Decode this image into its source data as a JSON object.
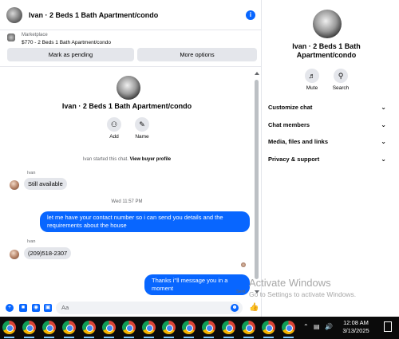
{
  "header": {
    "title": "Ivan · 2 Beds 1 Bath Apartment/condo",
    "info_glyph": "i"
  },
  "marketplace": {
    "label": "Marketplace",
    "listing": "$770 - 2 Beds 1 Bath Apartment/condo",
    "pending_label": "Mark as pending",
    "more_label": "More options"
  },
  "conversation": {
    "name": "Ivan · 2 Beds 1 Bath Apartment/condo",
    "add_label": "Add",
    "name_label": "Name",
    "system_prefix": "Ivan started this chat. ",
    "system_link": "View buyer profile",
    "messages": [
      {
        "sender": "Ivan",
        "text": "Still available"
      },
      {
        "timestamp": "Wed 11:57 PM"
      },
      {
        "text": "let me have your contact number so i can send you details and the requirements about the house"
      },
      {
        "sender": "Ivan",
        "text": "(209)518-2307"
      },
      {
        "text": "Thanks i''ll message you in a moment",
        "status": "Sent"
      }
    ]
  },
  "composer": {
    "placeholder": "Aa"
  },
  "info_panel": {
    "name": "Ivan · 2 Beds 1 Bath Apartment/condo",
    "mute_label": "Mute",
    "search_label": "Search",
    "rows": [
      "Customize chat",
      "Chat members",
      "Media, files and links",
      "Privacy & support"
    ]
  },
  "watermark": {
    "line1": "Activate Windows",
    "line2": "Go to Settings to activate Windows."
  },
  "taskbar": {
    "time": "12:08 AM",
    "date": "3/13/2025",
    "app_count": 15
  },
  "colors": {
    "accent": "#0866ff",
    "bubble_in": "#e4e6eb",
    "taskbar": "#0b0b0b"
  }
}
